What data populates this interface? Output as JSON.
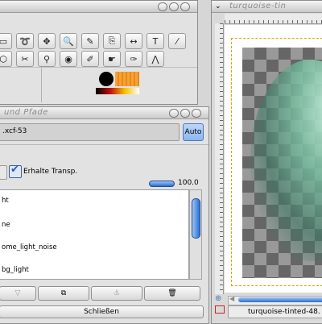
{
  "toolbox": {
    "tools": [
      {
        "name": "rect-select-icon",
        "glyph": "▭"
      },
      {
        "name": "free-select-icon",
        "glyph": "➰"
      },
      {
        "name": "move-icon",
        "glyph": "✥"
      },
      {
        "name": "zoom-icon",
        "glyph": "🔍"
      },
      {
        "name": "pencil-icon",
        "glyph": "✎"
      },
      {
        "name": "clone-icon",
        "glyph": "⎘"
      },
      {
        "name": "flip-icon",
        "glyph": "↔"
      },
      {
        "name": "text-icon",
        "glyph": "T"
      },
      {
        "name": "color-picker-icon",
        "glyph": "⁄"
      },
      {
        "name": "measure-icon",
        "glyph": "⬡"
      },
      {
        "name": "scissors-icon",
        "glyph": "✂"
      },
      {
        "name": "stamp-icon",
        "glyph": "⚲"
      },
      {
        "name": "drop-icon",
        "glyph": "◉"
      },
      {
        "name": "brush-icon",
        "glyph": "✐"
      },
      {
        "name": "smudge-icon",
        "glyph": "☛"
      },
      {
        "name": "path-icon",
        "glyph": "✑"
      },
      {
        "name": "compass-icon",
        "glyph": "⋀"
      }
    ],
    "fg_color": "#000000",
    "bg_color": "#f2a030"
  },
  "layers": {
    "title": "und Pfade",
    "image_name": ".xcf-53",
    "auto_label": "Auto",
    "keep_transp_label": "Erhalte Transp.",
    "opacity_value": "100.0",
    "items": [
      {
        "label": "ht"
      },
      {
        "label": "ne"
      },
      {
        "label": "ome_light_noise"
      },
      {
        "label": "bg_light"
      }
    ],
    "close_label": "Schließen"
  },
  "image_window": {
    "title": "turquoise-tin",
    "status_name": "turquoise-tinted-48."
  },
  "colors": {
    "accent": "#1e6bd6",
    "checkbox": "#2a70d8"
  }
}
